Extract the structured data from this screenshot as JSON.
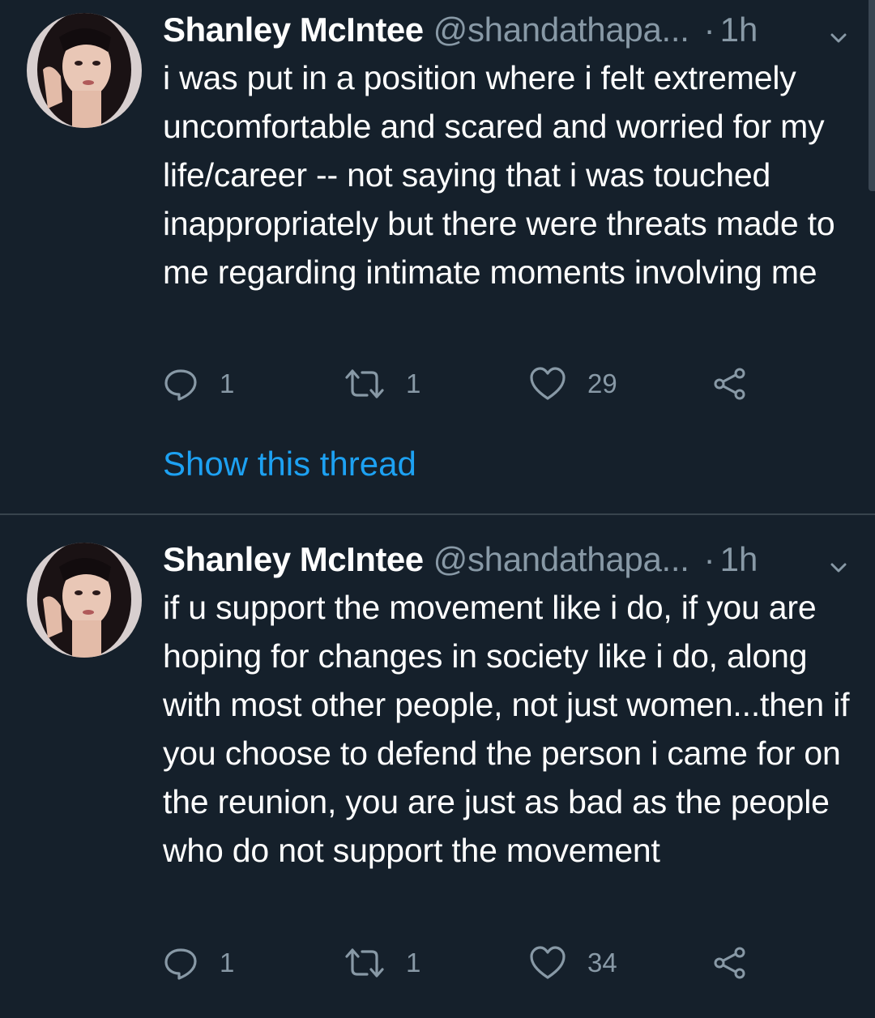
{
  "colors": {
    "background": "#15202b",
    "divider": "#38444d",
    "text_primary": "#ffffff",
    "text_secondary": "#8899a6",
    "link": "#1da1f2"
  },
  "tweets": [
    {
      "author_name": "Shanley McIntee",
      "handle": "@shandathapa...",
      "separator": "·",
      "time": "1h",
      "text": "i was put in a position where i felt extremely uncomfortable and scared and worried for my life/career -- not saying that i was touched inappropriately but there were threats made to me regarding intimate moments involving me",
      "replies": "1",
      "retweets": "1",
      "likes": "29",
      "thread_link": "Show this thread"
    },
    {
      "author_name": "Shanley McIntee",
      "handle": "@shandathapa...",
      "separator": "·",
      "time": "1h",
      "text": "if u support the movement like i do, if you are hoping for changes in society like i do, along with most other people, not just women...then if you choose to defend the person i came for on the reunion, you are just as bad as the people who do not support the movement",
      "replies": "1",
      "retweets": "1",
      "likes": "34"
    }
  ],
  "icons": {
    "reply": "reply-icon",
    "retweet": "retweet-icon",
    "like": "heart-icon",
    "share": "share-icon",
    "menu": "chevron-down-icon"
  }
}
